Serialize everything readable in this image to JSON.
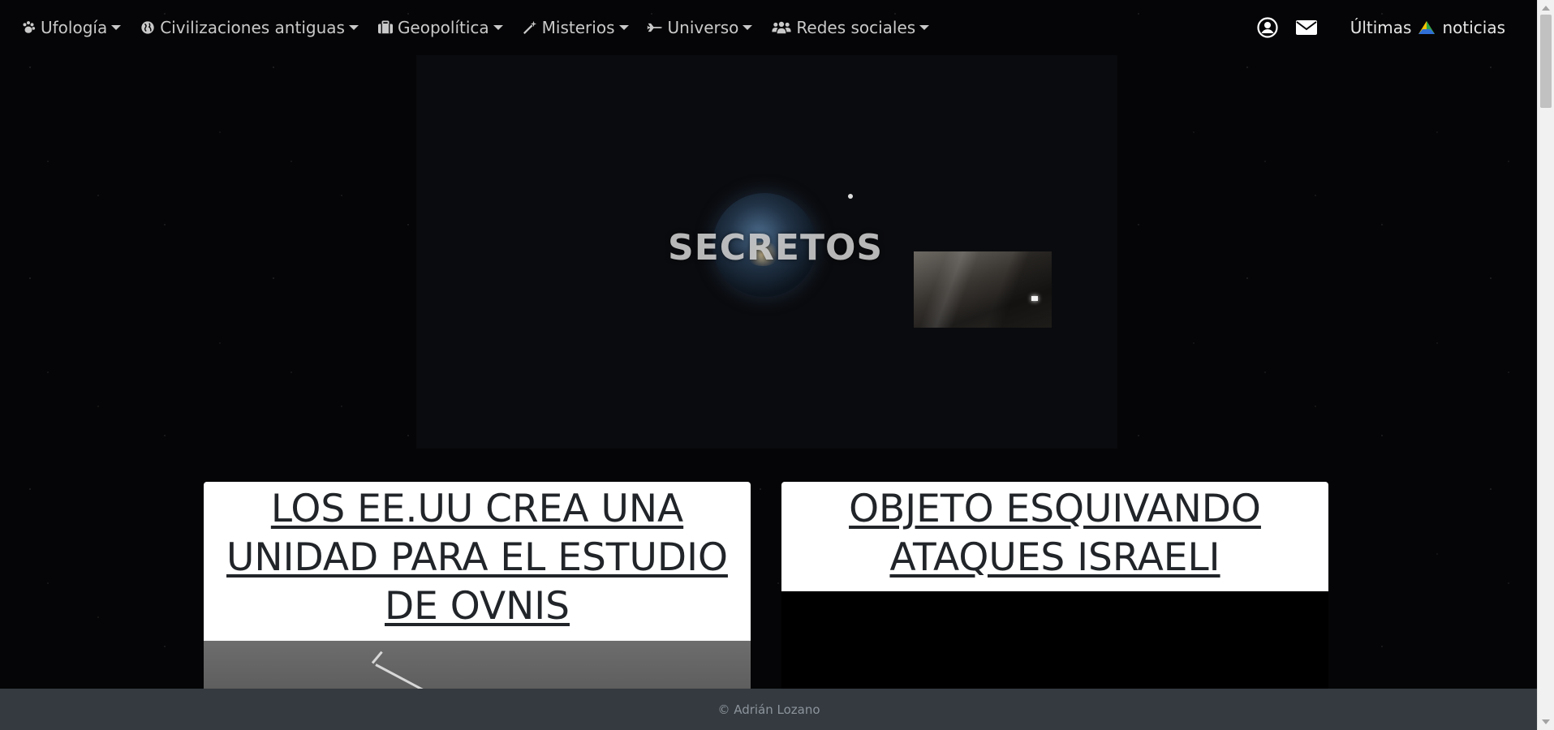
{
  "nav": {
    "items": [
      {
        "label": "Ufología",
        "icon": "paw-icon"
      },
      {
        "label": "Civilizaciones antiguas",
        "icon": "globe-icon"
      },
      {
        "label": "Geopolítica",
        "icon": "briefcase-icon"
      },
      {
        "label": "Misterios",
        "icon": "magic-wand-icon"
      },
      {
        "label": "Universo",
        "icon": "fighter-jet-icon"
      },
      {
        "label": "Redes sociales",
        "icon": "users-icon"
      }
    ],
    "account_icon": "user-circle-icon",
    "mail_icon": "envelope-icon",
    "news_before": "Últimas",
    "news_after": "noticias",
    "news_icon": "triangle-flag-icon"
  },
  "hero": {
    "title": "SECRETOS"
  },
  "cards": [
    {
      "title": "LOS EE.UU CREA UNA UNIDAD PARA EL ESTUDIO DE OVNIS"
    },
    {
      "title": "OBJETO ESQUIVANDO ATAQUES ISRAELI"
    }
  ],
  "footer": {
    "text": "© Adrián Lozano"
  },
  "colors": {
    "background": "#050507",
    "nav_text": "#c9c9c9",
    "footer_bg": "#343a40",
    "card_text": "#212529"
  }
}
